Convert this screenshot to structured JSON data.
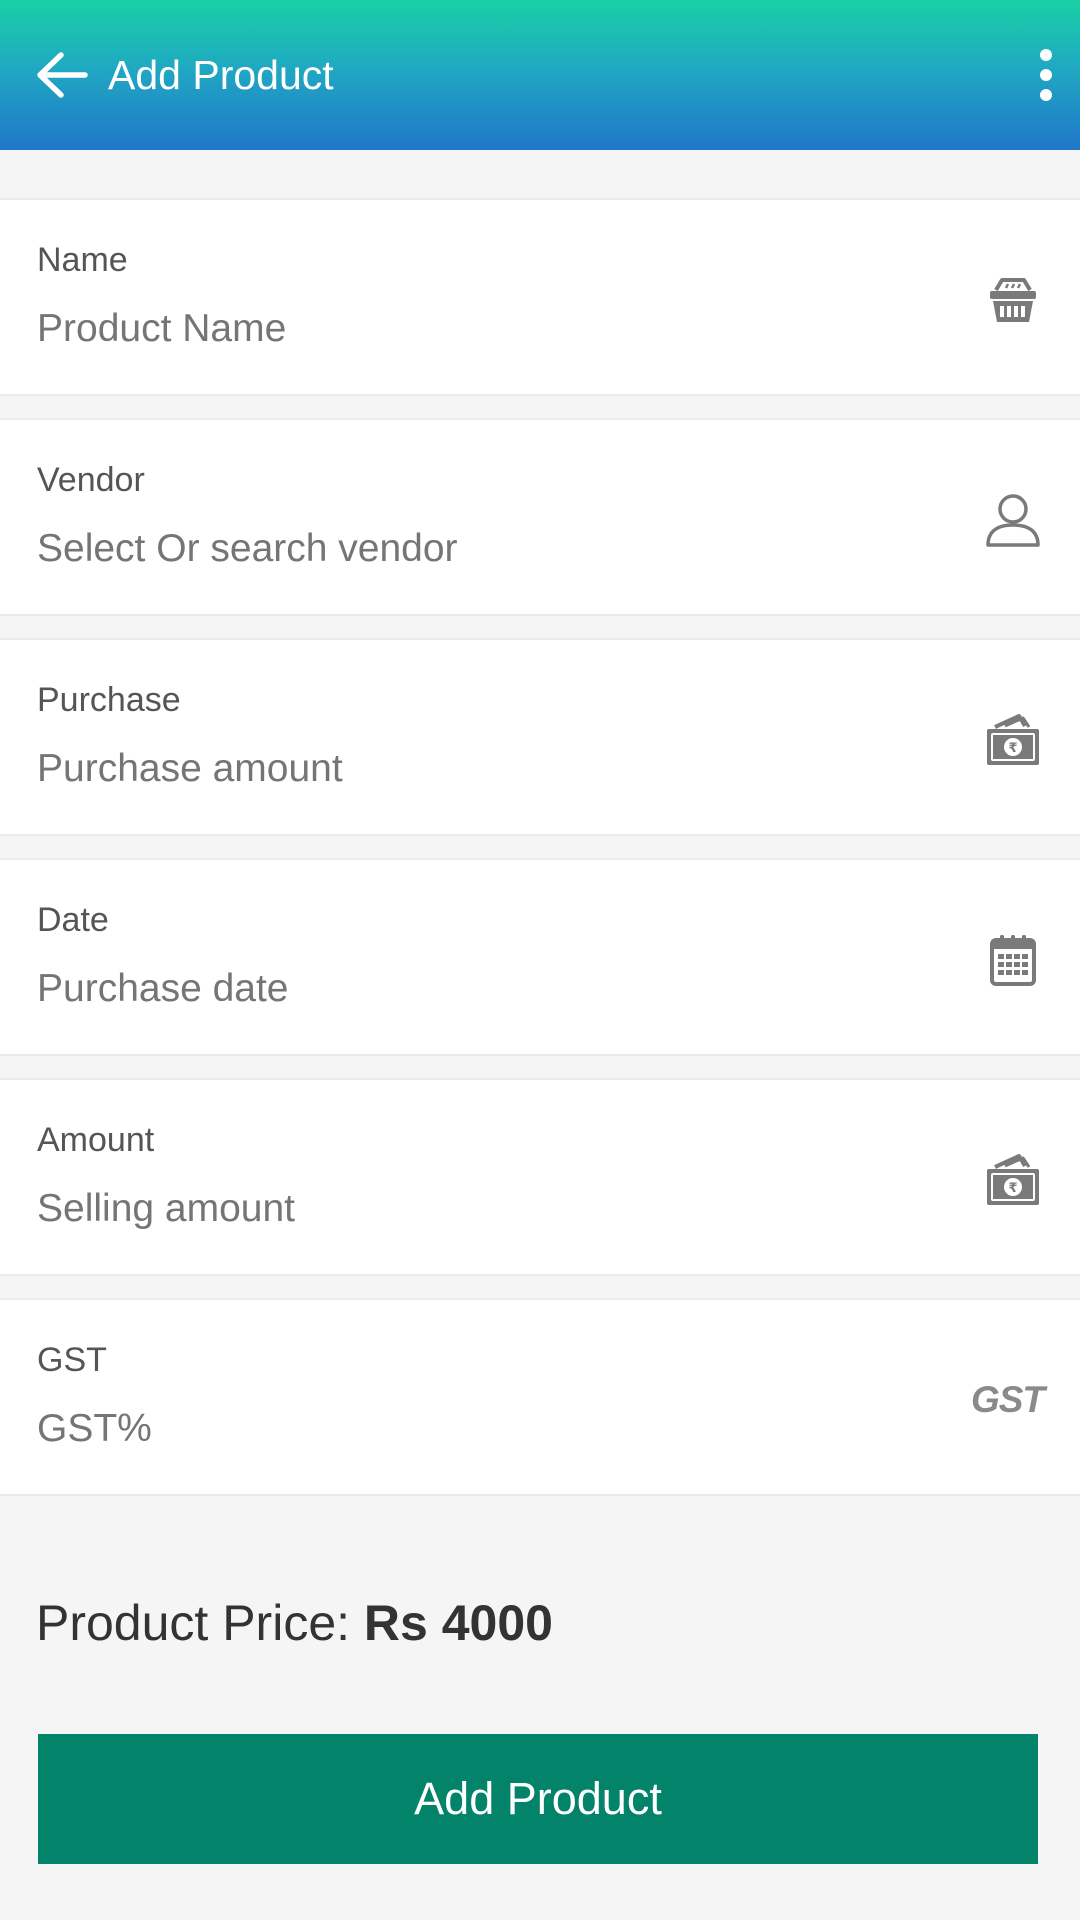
{
  "app_bar": {
    "title": "Add Product",
    "back_icon": "arrow-back-icon",
    "menu_icon": "more-vert-icon",
    "gradient_colors": [
      "#19d0a4",
      "#2176c9"
    ]
  },
  "fields": [
    {
      "label": "Name",
      "placeholder": "Product Name",
      "icon": "basket-icon"
    },
    {
      "label": "Vendor",
      "placeholder": "Select Or search vendor",
      "icon": "person-icon"
    },
    {
      "label": "Purchase",
      "placeholder": "Purchase amount",
      "icon": "money-icon"
    },
    {
      "label": "Date",
      "placeholder": "Purchase date",
      "icon": "calendar-icon"
    },
    {
      "label": "Amount",
      "placeholder": "Selling amount",
      "icon": "money-icon"
    },
    {
      "label": "GST",
      "placeholder": "GST%",
      "icon": "gst-icon",
      "icon_text": "GST"
    }
  ],
  "summary": {
    "price_label": "Product Price: ",
    "price_value": "Rs 4000"
  },
  "actions": {
    "submit_label": "Add Product",
    "submit_color": "#03836a"
  }
}
